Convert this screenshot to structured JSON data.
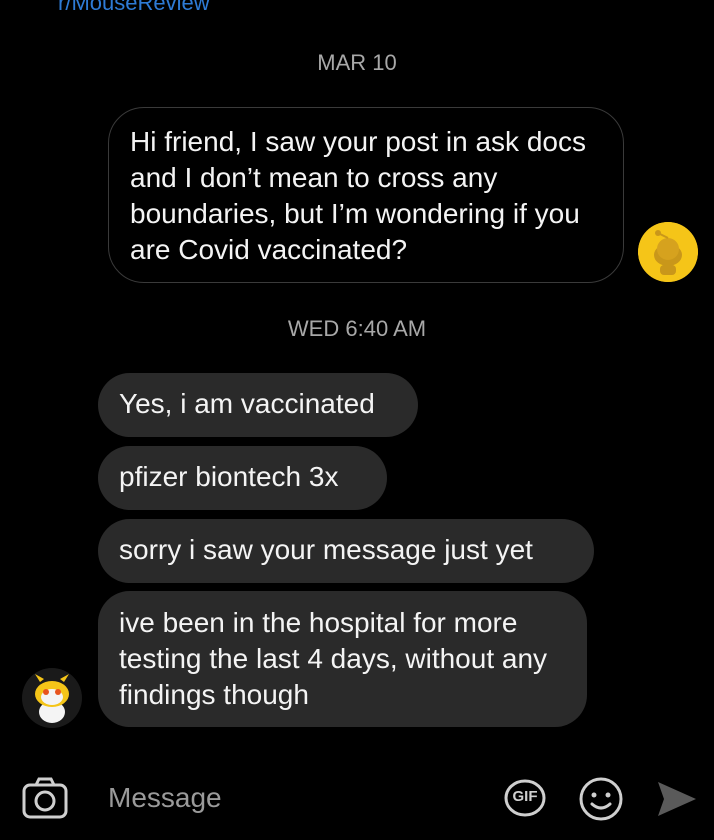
{
  "header": {
    "subreddit_link": "r/MouseReview"
  },
  "separators": {
    "first": "MAR 10",
    "second": "WED 6:40 AM"
  },
  "messages": {
    "outgoing": [
      "Hi friend, I saw your post in ask docs and I don’t mean to cross any boundaries, but I’m wondering if you are Covid vaccinated?"
    ],
    "incoming": [
      "Yes, i am vaccinated",
      "pfizer biontech 3x",
      "sorry i saw your message just yet",
      "ive been in the hospital for more testing the last 4 days, without any findings though"
    ]
  },
  "composer": {
    "placeholder": "Message",
    "gif_label": "GIF",
    "icons": [
      "camera-icon",
      "gif-icon",
      "emoji-icon",
      "send-icon"
    ]
  },
  "colors": {
    "background": "#000000",
    "incoming_bubble": "#2a2a2a",
    "outgoing_border": "#3a3a3a",
    "link": "#2e7bd6",
    "avatar_yellow": "#f5c518"
  }
}
